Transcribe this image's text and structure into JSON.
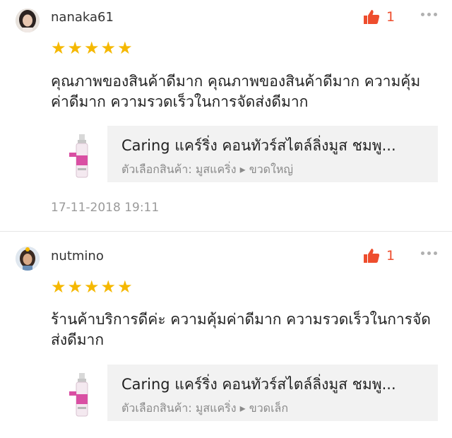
{
  "reviews": [
    {
      "username": "nanaka61",
      "like_count": "1",
      "rating_stars": 5,
      "comment": " คุณภาพของสินค้าดีมาก คุณภาพของสินค้าดีมาก ความคุ้มค่าดีมาก ความรวดเร็วในการจัดส่งดีมาก",
      "product_name": "Caring แคร์ริ่ง คอนทัวร์สไตล์ลิ่งมูส ชมพู...",
      "variant": "ตัวเลือกสินค้า: มูสแคริ่ง ▸ ขวดใหญ่",
      "date": "17-11-2018 19:11"
    },
    {
      "username": "nutmino",
      "like_count": "1",
      "rating_stars": 5,
      "comment": "ร้านค้าบริการดีค่ะ ความคุ้มค่าดีมาก ความรวดเร็วในการจัดส่งดีมาก",
      "product_name": "Caring แคร์ริ่ง คอนทัวร์สไตล์ลิ่งมูส ชมพู...",
      "variant": "ตัวเลือกสินค้า: มูสแคริ่ง ▸ ขวดเล็ก"
    }
  ],
  "colors": {
    "accent": "#ee4d2d",
    "star": "#f5b800",
    "product_card_bg": "#f2f2f2",
    "muted_text": "#9a9a9a"
  },
  "icons": [
    "thumbs-up-icon",
    "more-dots-icon",
    "star-icon",
    "avatar",
    "product-thumbnail"
  ]
}
